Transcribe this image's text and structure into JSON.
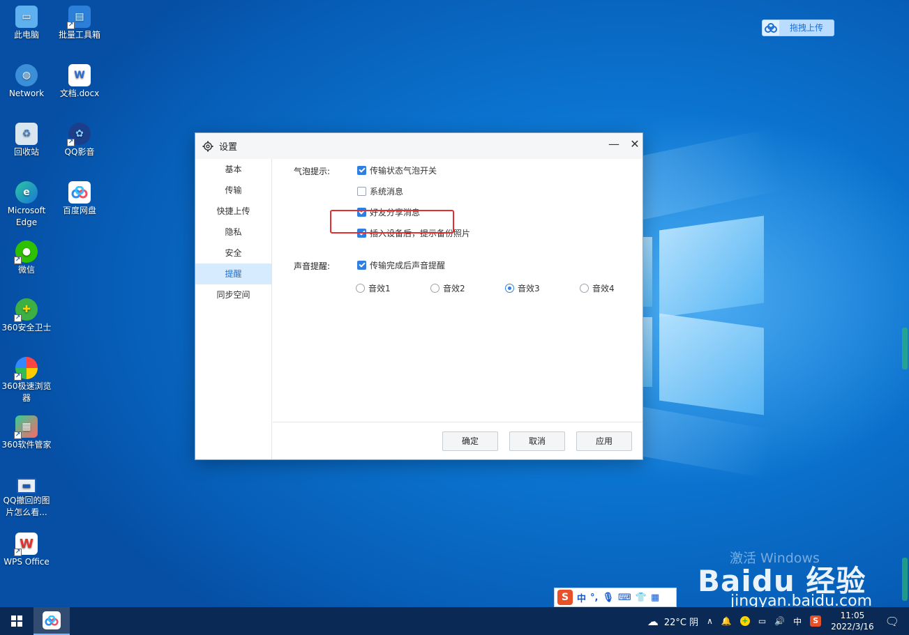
{
  "desktop": {
    "icons": [
      {
        "label": "此电脑"
      },
      {
        "label": "批量工具箱"
      },
      {
        "label": "Network"
      },
      {
        "label": "文档.docx"
      },
      {
        "label": "回收站"
      },
      {
        "label": "QQ影音"
      },
      {
        "label": "Microsoft Edge"
      },
      {
        "label": "百度网盘"
      },
      {
        "label": "微信"
      },
      {
        "label": "360安全卫士"
      },
      {
        "label": "360极速浏览器"
      },
      {
        "label": "360软件管家"
      },
      {
        "label": "QQ撤回的图片怎么看..."
      },
      {
        "label": "WPS Office"
      }
    ],
    "drag_upload_label": "拖拽上传"
  },
  "dialog": {
    "title": "设置",
    "minimize_glyph": "—",
    "close_glyph": "✕",
    "sidebar": [
      {
        "label": "基本",
        "active": false
      },
      {
        "label": "传输",
        "active": false
      },
      {
        "label": "快捷上传",
        "active": false
      },
      {
        "label": "隐私",
        "active": false
      },
      {
        "label": "安全",
        "active": false
      },
      {
        "label": "提醒",
        "active": true
      },
      {
        "label": "同步空间",
        "active": false
      }
    ],
    "bubble": {
      "label": "气泡提示:",
      "options": [
        {
          "label": "传输状态气泡开关",
          "checked": true
        },
        {
          "label": "系统消息",
          "checked": false
        },
        {
          "label": "好友分享消息",
          "checked": true
        },
        {
          "label": "插入设备后，提示备份照片",
          "checked": true
        }
      ]
    },
    "sound": {
      "label": "声音提醒:",
      "checkbox": {
        "label": "传输完成后声音提醒",
        "checked": true
      },
      "effects": [
        {
          "label": "音效1",
          "selected": false
        },
        {
          "label": "音效2",
          "selected": false
        },
        {
          "label": "音效3",
          "selected": true
        },
        {
          "label": "音效4",
          "selected": false
        }
      ]
    },
    "buttons": {
      "ok": "确定",
      "cancel": "取消",
      "apply": "应用"
    }
  },
  "watermark": {
    "activate": "激活 Windows",
    "brand": "Baidu 经验",
    "url": "jingyan.baidu.com"
  },
  "ime": {
    "chinese": "中",
    "punct": "°,"
  },
  "taskbar": {
    "weather": "22°C 阴",
    "ime_mode": "中",
    "time": "11:05",
    "date": "2022/3/16"
  },
  "colors": {
    "accent": "#2f7fe0",
    "highlight": "#e52d2d",
    "taskbar": "#0a2a55"
  }
}
